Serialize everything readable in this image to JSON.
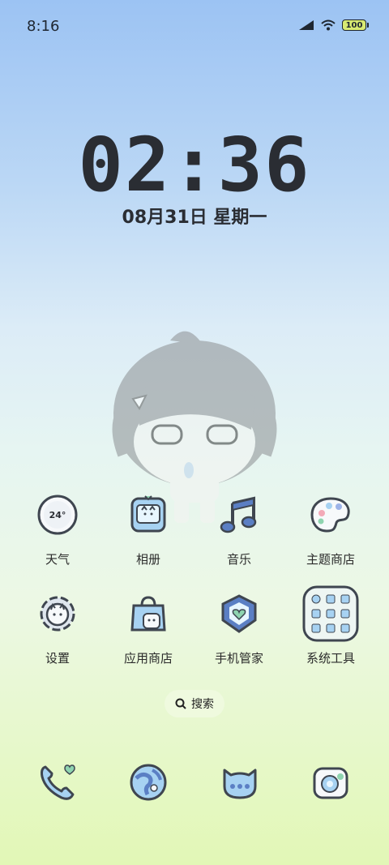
{
  "status_bar": {
    "time": "8:16",
    "battery": "100"
  },
  "clock": {
    "time": "02:36",
    "date": "08月31日 星期一"
  },
  "apps": [
    {
      "label": "天气",
      "icon": "weather-icon",
      "badge": "24°"
    },
    {
      "label": "相册",
      "icon": "gallery-icon"
    },
    {
      "label": "音乐",
      "icon": "music-icon"
    },
    {
      "label": "主题商店",
      "icon": "theme-store-icon"
    },
    {
      "label": "设置",
      "icon": "settings-icon"
    },
    {
      "label": "应用商店",
      "icon": "app-store-icon"
    },
    {
      "label": "手机管家",
      "icon": "phone-manager-icon"
    },
    {
      "label": "系统工具",
      "icon": "system-tools-folder-icon"
    }
  ],
  "search": {
    "label": "搜索"
  },
  "dock": [
    {
      "icon": "phone-icon"
    },
    {
      "icon": "browser-icon"
    },
    {
      "icon": "messages-icon"
    },
    {
      "icon": "camera-icon"
    }
  ],
  "colors": {
    "icon_blue": "#a7d2f2",
    "outline": "#3f4650",
    "accent_green": "#8fd4b0"
  }
}
